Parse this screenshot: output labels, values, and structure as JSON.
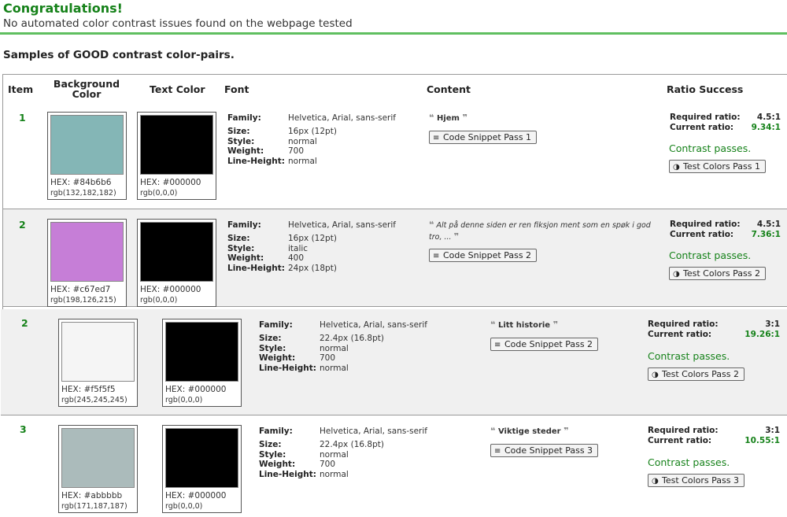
{
  "header": {
    "title": "Congratulations!",
    "subtitle": "No automated color contrast issues found on the webpage tested"
  },
  "samples_title": "Samples of GOOD contrast color-pairs.",
  "columns": {
    "item": "Item",
    "background": "Background Color",
    "text_color": "Text Color",
    "font": "Font",
    "content": "Content",
    "ratio": "Ratio Success"
  },
  "labels": {
    "family": "Family:",
    "size": "Size:",
    "style": "Style:",
    "weight": "Weight:",
    "line_height": "Line-Height:",
    "required": "Required ratio:",
    "current": "Current ratio:",
    "open_quote": "❝",
    "close_quote": "❞",
    "snippet_icon": "≡",
    "contrast_icon": "◑"
  },
  "rows": [
    {
      "item": "1",
      "bg_color": "#84b6b6",
      "bg_hex": "HEX: #84b6b6",
      "bg_rgb": "rgb(132,182,182)",
      "text_color": "#000000",
      "text_hex": "HEX: #000000",
      "text_rgb": "rgb(0,0,0)",
      "family": "Helvetica, Arial, sans-serif",
      "size": "16px (12pt)",
      "style": "normal",
      "weight": "700",
      "line_height": "normal",
      "content": "Hjem",
      "snippet": "Code Snippet Pass 1",
      "required": "4.5:1",
      "current": "9.34:1",
      "result": "Contrast passes.",
      "test": "Test Colors Pass 1"
    },
    {
      "item": "2",
      "bg_color": "#c67ed7",
      "bg_hex": "HEX: #c67ed7",
      "bg_rgb": "rgb(198,126,215)",
      "text_color": "#000000",
      "text_hex": "HEX: #000000",
      "text_rgb": "rgb(0,0,0)",
      "family": "Helvetica, Arial, sans-serif",
      "size": "16px (12pt)",
      "style": "italic",
      "weight": "400",
      "line_height": "24px (18pt)",
      "content": "Alt på denne siden er ren fiksjon ment som en spøk i god tro, ...",
      "snippet": "Code Snippet Pass 2",
      "required": "4.5:1",
      "current": "7.36:1",
      "result": "Contrast passes.",
      "test": "Test Colors Pass 2"
    },
    {
      "item": "2",
      "bg_color": "#f5f5f5",
      "bg_hex": "HEX: #f5f5f5",
      "bg_rgb": "rgb(245,245,245)",
      "text_color": "#000000",
      "text_hex": "HEX: #000000",
      "text_rgb": "rgb(0,0,0)",
      "family": "Helvetica, Arial, sans-serif",
      "size": "22.4px (16.8pt)",
      "style": "normal",
      "weight": "700",
      "line_height": "normal",
      "content": "Litt historie",
      "snippet": "Code Snippet Pass 2",
      "required": "3:1",
      "current": "19.26:1",
      "result": "Contrast passes.",
      "test": "Test Colors Pass 2"
    },
    {
      "item": "3",
      "bg_color": "#abbbbb",
      "bg_hex": "HEX: #abbbbb",
      "bg_rgb": "rgb(171,187,187)",
      "text_color": "#000000",
      "text_hex": "HEX: #000000",
      "text_rgb": "rgb(0,0,0)",
      "family": "Helvetica, Arial, sans-serif",
      "size": "22.4px (16.8pt)",
      "style": "normal",
      "weight": "700",
      "line_height": "normal",
      "content": "Viktige steder",
      "snippet": "Code Snippet Pass 3",
      "required": "3:1",
      "current": "10.55:1",
      "result": "Contrast passes.",
      "test": "Test Colors Pass 3"
    }
  ]
}
